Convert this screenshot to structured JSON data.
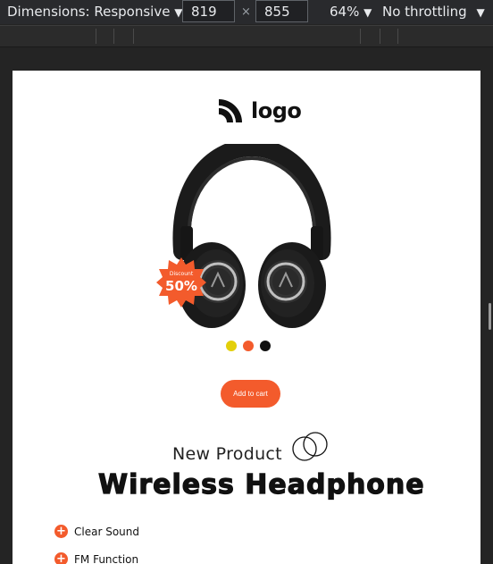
{
  "devtools": {
    "dimensions_label": "Dimensions: Responsive",
    "width_value": "819",
    "times_symbol": "×",
    "height_value": "855",
    "zoom_label": "64%",
    "throttling_label": "No throttling",
    "caret": "▼"
  },
  "page": {
    "logo_text": "logo",
    "badge_top": "Discount",
    "badge_value": "50%",
    "color_options": [
      "#e3cf0a",
      "#f35b2c",
      "#111111"
    ],
    "add_to_cart": "Add to cart",
    "new_product": "New Product",
    "product_title": "Wireless Headphone",
    "plus_symbol": "+",
    "features": [
      "Clear Sound",
      "FM Function"
    ]
  },
  "colors": {
    "accent": "#f35b2c",
    "devtools_bg": "#292a2d"
  }
}
